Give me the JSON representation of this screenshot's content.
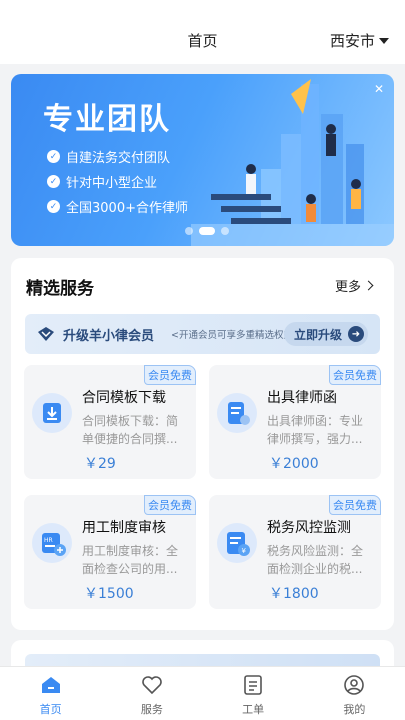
{
  "header": {
    "title": "首页",
    "city": "西安市"
  },
  "banner": {
    "title": "专业团队",
    "bullets": [
      "自建法务交付团队",
      "针对中小型企业",
      "全国3000+合作律师"
    ],
    "slides": 3,
    "active_slide": 2
  },
  "section": {
    "title": "精选服务",
    "more_label": "更多"
  },
  "vip": {
    "title": "升级羊小律会员",
    "subtitle": "<开通会员可享多重精选权益>",
    "button": "立即升级"
  },
  "services": [
    {
      "badge": "会员免费",
      "name": "合同模板下载",
      "desc": "合同模板下载：简单便捷的合同撰...",
      "price": "￥29",
      "icon": "download-icon"
    },
    {
      "badge": "会员免费",
      "name": "出具律师函",
      "desc": "出具律师函：专业律师撰写，强力...",
      "price": "￥2000",
      "icon": "letter-icon"
    },
    {
      "badge": "会员免费",
      "name": "用工制度审核",
      "desc": "用工制度审核：全面检查公司的用...",
      "price": "￥1500",
      "icon": "hr-icon"
    },
    {
      "badge": "会员免费",
      "name": "税务风控监测",
      "desc": "税务风险监测：全面检测企业的税...",
      "price": "￥1800",
      "icon": "tax-icon"
    }
  ],
  "tabs": [
    {
      "label": "首页",
      "icon": "home-icon",
      "active": true
    },
    {
      "label": "服务",
      "icon": "heart-icon",
      "active": false
    },
    {
      "label": "工单",
      "icon": "list-icon",
      "active": false
    },
    {
      "label": "我的",
      "icon": "profile-icon",
      "active": false
    }
  ],
  "colors": {
    "accent": "#3a8af2",
    "price": "#3a7fd6",
    "background": "#f2f3f5"
  }
}
